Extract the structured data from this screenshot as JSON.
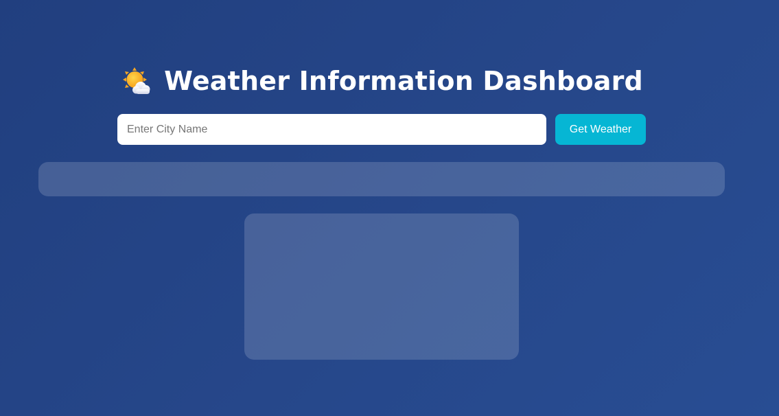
{
  "header": {
    "icon": "sun-behind-cloud-icon",
    "title": "Weather Information Dashboard"
  },
  "search": {
    "placeholder": "Enter City Name",
    "value": "",
    "button_label": "Get Weather"
  },
  "colors": {
    "background_start": "#213f7f",
    "background_end": "#284d93",
    "accent_button": "#06b6d4",
    "panel": "rgba(255,255,255,0.16)"
  }
}
